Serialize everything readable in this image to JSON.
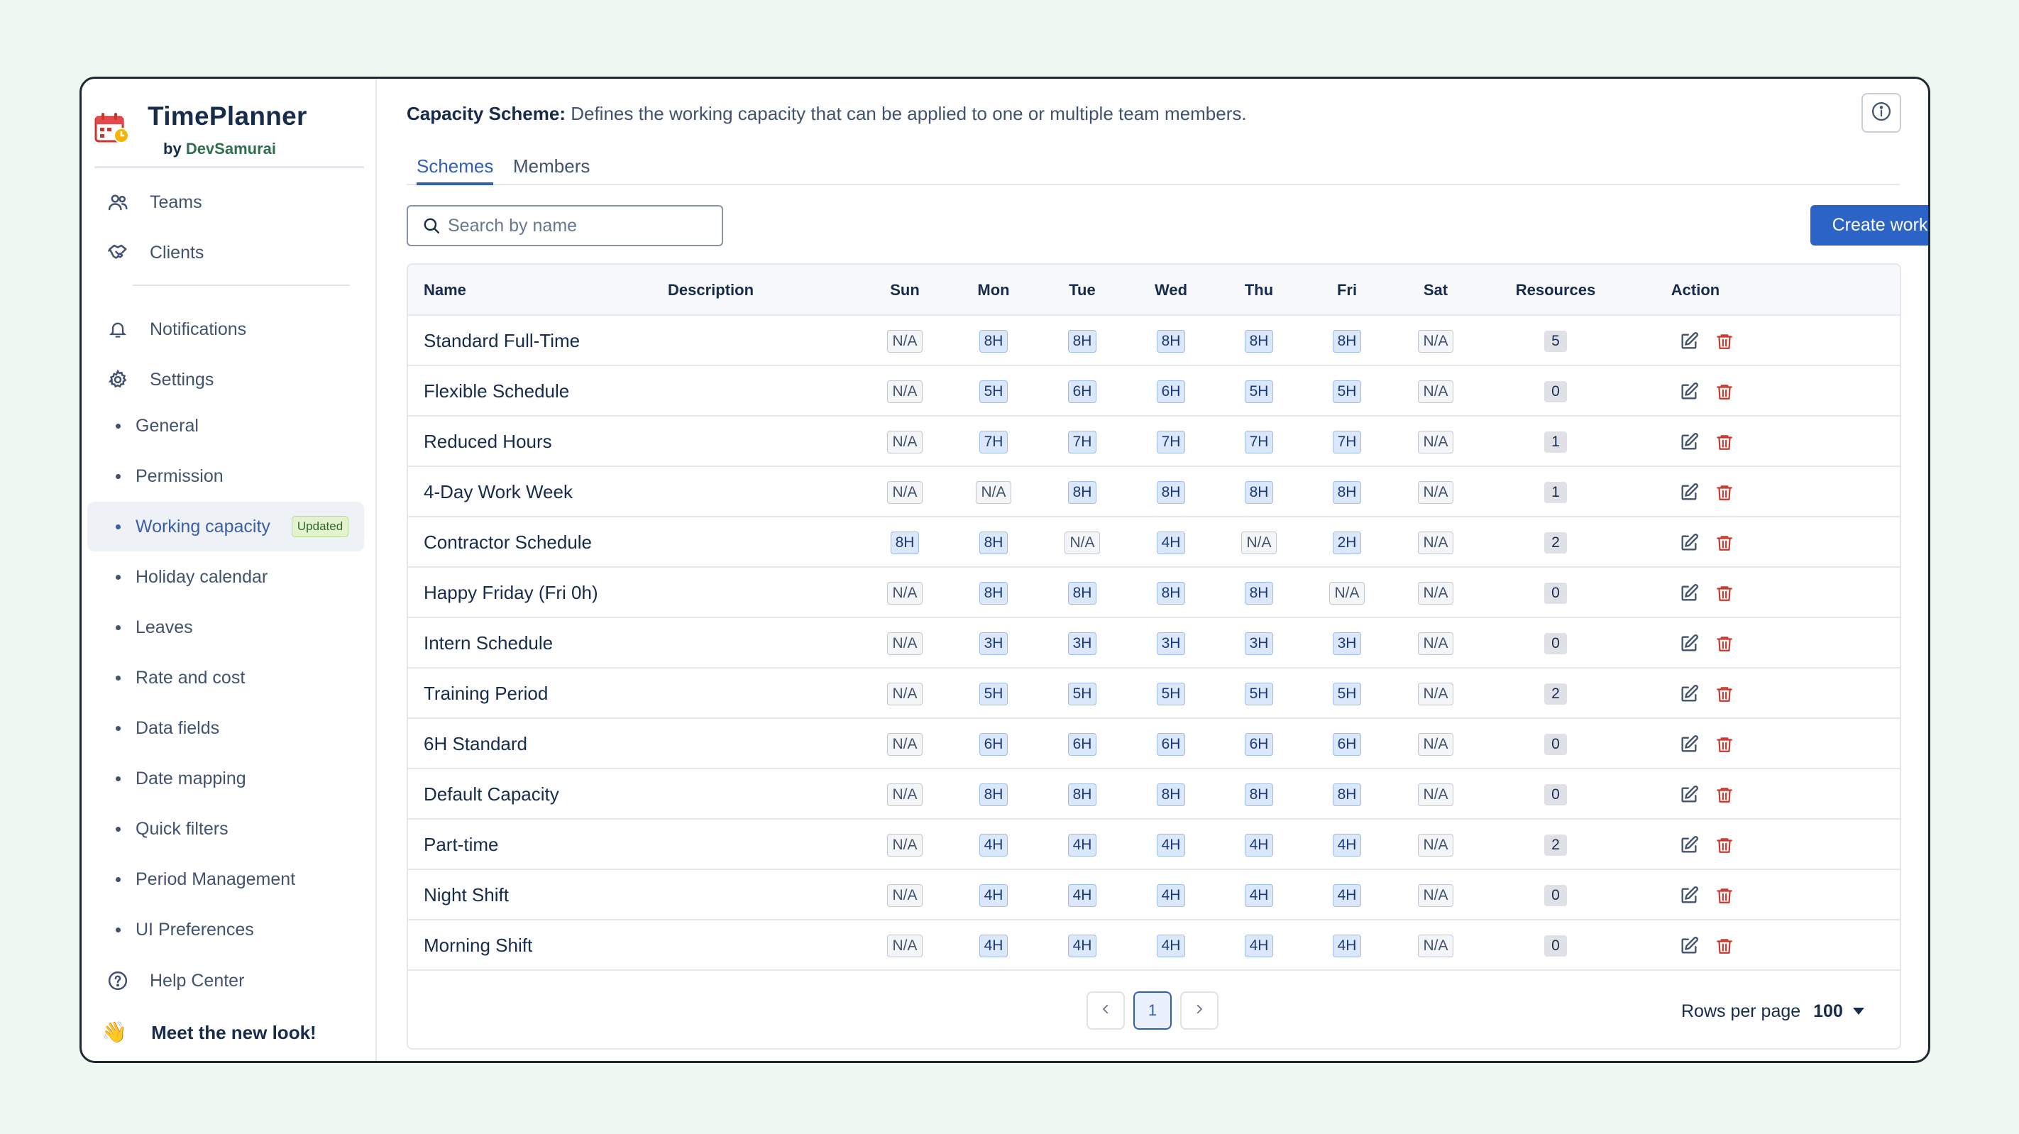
{
  "app": {
    "title": "TimePlanner",
    "by_prefix": "by",
    "by_org": "DevSamurai"
  },
  "sidebar": {
    "nav": [
      {
        "label": "Teams",
        "icon": "users-icon"
      },
      {
        "label": "Clients",
        "icon": "handshake-icon"
      },
      {
        "label": "Notifications",
        "icon": "bell-icon"
      },
      {
        "label": "Settings",
        "icon": "gear-icon"
      }
    ],
    "settings_items": [
      {
        "label": "General"
      },
      {
        "label": "Permission"
      },
      {
        "label": "Working capacity",
        "active": true,
        "badge": "Updated"
      },
      {
        "label": "Holiday calendar"
      },
      {
        "label": "Leaves"
      },
      {
        "label": "Rate and cost"
      },
      {
        "label": "Data fields"
      },
      {
        "label": "Date mapping"
      },
      {
        "label": "Quick filters"
      },
      {
        "label": "Period Management"
      },
      {
        "label": "UI Preferences"
      }
    ],
    "help": {
      "label": "Help Center",
      "icon": "help-circle-icon"
    },
    "new_look": {
      "emoji": "👋",
      "label": "Meet the new look!"
    }
  },
  "header": {
    "scheme_label": "Capacity Scheme:",
    "scheme_description": "Defines the working capacity that can be applied to one or multiple team members."
  },
  "tabs": [
    {
      "label": "Schemes",
      "active": true
    },
    {
      "label": "Members",
      "active": false
    }
  ],
  "search": {
    "placeholder": "Search by name",
    "value": ""
  },
  "create_button": {
    "label": "Create working capacity"
  },
  "table": {
    "columns": [
      "Name",
      "Description",
      "Sun",
      "Mon",
      "Tue",
      "Wed",
      "Thu",
      "Fri",
      "Sat",
      "Resources",
      "Action"
    ],
    "rows": [
      {
        "name": "Standard Full-Time",
        "description": "",
        "days": [
          "N/A",
          "8H",
          "8H",
          "8H",
          "8H",
          "8H",
          "N/A"
        ],
        "resources": "5"
      },
      {
        "name": "Flexible Schedule",
        "description": "",
        "days": [
          "N/A",
          "5H",
          "6H",
          "6H",
          "5H",
          "5H",
          "N/A"
        ],
        "resources": "0"
      },
      {
        "name": "Reduced Hours",
        "description": "",
        "days": [
          "N/A",
          "7H",
          "7H",
          "7H",
          "7H",
          "7H",
          "N/A"
        ],
        "resources": "1"
      },
      {
        "name": "4-Day Work Week",
        "description": "",
        "days": [
          "N/A",
          "N/A",
          "8H",
          "8H",
          "8H",
          "8H",
          "N/A"
        ],
        "resources": "1"
      },
      {
        "name": "Contractor Schedule",
        "description": "",
        "days": [
          "8H",
          "8H",
          "N/A",
          "4H",
          "N/A",
          "2H",
          "N/A"
        ],
        "resources": "2"
      },
      {
        "name": "Happy Friday (Fri 0h)",
        "description": "",
        "days": [
          "N/A",
          "8H",
          "8H",
          "8H",
          "8H",
          "N/A",
          "N/A"
        ],
        "resources": "0"
      },
      {
        "name": "Intern Schedule",
        "description": "",
        "days": [
          "N/A",
          "3H",
          "3H",
          "3H",
          "3H",
          "3H",
          "N/A"
        ],
        "resources": "0"
      },
      {
        "name": "Training Period",
        "description": "",
        "days": [
          "N/A",
          "5H",
          "5H",
          "5H",
          "5H",
          "5H",
          "N/A"
        ],
        "resources": "2"
      },
      {
        "name": "6H Standard",
        "description": "",
        "days": [
          "N/A",
          "6H",
          "6H",
          "6H",
          "6H",
          "6H",
          "N/A"
        ],
        "resources": "0"
      },
      {
        "name": "Default Capacity",
        "description": "",
        "days": [
          "N/A",
          "8H",
          "8H",
          "8H",
          "8H",
          "8H",
          "N/A"
        ],
        "resources": "0"
      },
      {
        "name": "Part-time",
        "description": "",
        "days": [
          "N/A",
          "4H",
          "4H",
          "4H",
          "4H",
          "4H",
          "N/A"
        ],
        "resources": "2"
      },
      {
        "name": "Night Shift",
        "description": "",
        "days": [
          "N/A",
          "4H",
          "4H",
          "4H",
          "4H",
          "4H",
          "N/A"
        ],
        "resources": "0"
      },
      {
        "name": "Morning Shift",
        "description": "",
        "days": [
          "N/A",
          "4H",
          "4H",
          "4H",
          "4H",
          "4H",
          "N/A"
        ],
        "resources": "0"
      }
    ]
  },
  "pagination": {
    "current_page": "1",
    "rows_per_page_label": "Rows per page",
    "rows_per_page_value": "100"
  },
  "colors": {
    "primary": "#2b63c6",
    "active_nav": "#3b5ea8",
    "badge_bg": "#e3f3cf",
    "delete_icon": "#c9372c",
    "background": "#eef7f1"
  }
}
